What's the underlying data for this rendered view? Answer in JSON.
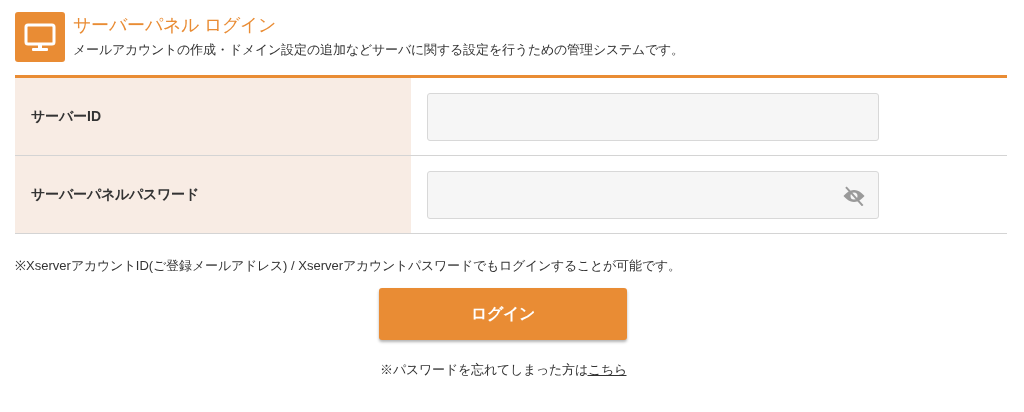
{
  "header": {
    "title": "サーバーパネル ログイン",
    "description": "メールアカウントの作成・ドメイン設定の追加などサーバに関する設定を行うための管理システムです。"
  },
  "fields": [
    {
      "label": "サーバーID",
      "kind": "text"
    },
    {
      "label": "サーバーパネルパスワード",
      "kind": "password"
    }
  ],
  "note": "※XserverアカウントID(ご登録メールアドレス) / Xserverアカウントパスワードでもログインすることが可能です。",
  "login_button": "ログイン",
  "forgot": {
    "text": "※パスワードを忘れてしまった方は",
    "link": "こちら"
  }
}
